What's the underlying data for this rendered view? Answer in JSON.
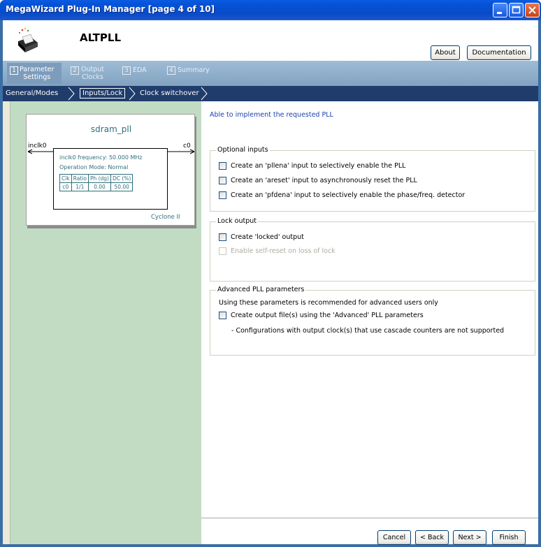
{
  "window": {
    "title": "MegaWizard Plug-In Manager [page 4 of 10]"
  },
  "header": {
    "app_title": "ALTPLL",
    "icon": "altpll-wizard-icon",
    "about_label": "About",
    "documentation_label": "Documentation"
  },
  "tabs": [
    {
      "num": "1",
      "label": "Parameter\nSettings"
    },
    {
      "num": "2",
      "label": "Output\nClocks"
    },
    {
      "num": "3",
      "label": "EDA"
    },
    {
      "num": "4",
      "label": "Summary"
    }
  ],
  "crumbs": [
    "General/Modes",
    "Inputs/Lock",
    "Clock switchover"
  ],
  "block": {
    "name": "sdram_pll",
    "input_port": "inclk0",
    "output_port": "c0",
    "freq_text": "inclk0 frequency: 50.000 MHz",
    "mode_text": "Operation Mode: Normal",
    "table_headers": [
      "Clk",
      "Ratio",
      "Ph (dg)",
      "DC (%)"
    ],
    "table_row": [
      "c0",
      "1/1",
      "0.00",
      "50.00"
    ],
    "device": "Cyclone II"
  },
  "status_text": "Able to implement the requested PLL",
  "optional_inputs": {
    "title": "Optional inputs",
    "items": [
      "Create an 'pllena' input to selectively enable the PLL",
      "Create an 'areset' input to asynchronously reset the PLL",
      "Create an 'pfdena' input to selectively enable the phase/freq. detector"
    ]
  },
  "lock_output": {
    "title": "Lock output",
    "create_locked": "Create 'locked' output",
    "self_reset": "Enable self-reset on loss of lock"
  },
  "advanced": {
    "title": "Advanced PLL parameters",
    "note": "Using these parameters is recommended for advanced users only",
    "create_output": "Create output file(s) using the 'Advanced' PLL parameters",
    "config_note": "- Configurations with output clock(s) that use cascade counters are not supported"
  },
  "footer": {
    "cancel": "Cancel",
    "back": "< Back",
    "next": "Next >",
    "finish": "Finish"
  }
}
